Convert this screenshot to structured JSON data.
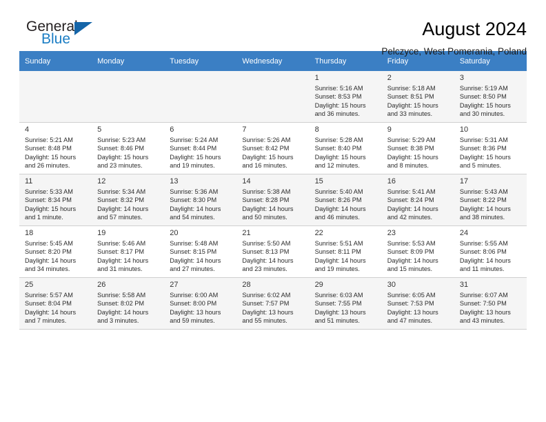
{
  "brand": {
    "name_part1": "General",
    "name_part2": "Blue",
    "triangle_color": "#1565a8",
    "blue_color": "#1a7dc4"
  },
  "header": {
    "title": "August 2024",
    "subtitle": "Pelczyce, West Pomerania, Poland"
  },
  "calendar": {
    "header_bg": "#3b7fc4",
    "header_text_color": "#ffffff",
    "alt_row_bg": "#f5f5f5",
    "weekday_headers": [
      "Sunday",
      "Monday",
      "Tuesday",
      "Wednesday",
      "Thursday",
      "Friday",
      "Saturday"
    ],
    "weeks": [
      [
        {
          "day": "",
          "detail": ""
        },
        {
          "day": "",
          "detail": ""
        },
        {
          "day": "",
          "detail": ""
        },
        {
          "day": "",
          "detail": ""
        },
        {
          "day": "1",
          "detail": "Sunrise: 5:16 AM\nSunset: 8:53 PM\nDaylight: 15 hours\nand 36 minutes."
        },
        {
          "day": "2",
          "detail": "Sunrise: 5:18 AM\nSunset: 8:51 PM\nDaylight: 15 hours\nand 33 minutes."
        },
        {
          "day": "3",
          "detail": "Sunrise: 5:19 AM\nSunset: 8:50 PM\nDaylight: 15 hours\nand 30 minutes."
        }
      ],
      [
        {
          "day": "4",
          "detail": "Sunrise: 5:21 AM\nSunset: 8:48 PM\nDaylight: 15 hours\nand 26 minutes."
        },
        {
          "day": "5",
          "detail": "Sunrise: 5:23 AM\nSunset: 8:46 PM\nDaylight: 15 hours\nand 23 minutes."
        },
        {
          "day": "6",
          "detail": "Sunrise: 5:24 AM\nSunset: 8:44 PM\nDaylight: 15 hours\nand 19 minutes."
        },
        {
          "day": "7",
          "detail": "Sunrise: 5:26 AM\nSunset: 8:42 PM\nDaylight: 15 hours\nand 16 minutes."
        },
        {
          "day": "8",
          "detail": "Sunrise: 5:28 AM\nSunset: 8:40 PM\nDaylight: 15 hours\nand 12 minutes."
        },
        {
          "day": "9",
          "detail": "Sunrise: 5:29 AM\nSunset: 8:38 PM\nDaylight: 15 hours\nand 8 minutes."
        },
        {
          "day": "10",
          "detail": "Sunrise: 5:31 AM\nSunset: 8:36 PM\nDaylight: 15 hours\nand 5 minutes."
        }
      ],
      [
        {
          "day": "11",
          "detail": "Sunrise: 5:33 AM\nSunset: 8:34 PM\nDaylight: 15 hours\nand 1 minute."
        },
        {
          "day": "12",
          "detail": "Sunrise: 5:34 AM\nSunset: 8:32 PM\nDaylight: 14 hours\nand 57 minutes."
        },
        {
          "day": "13",
          "detail": "Sunrise: 5:36 AM\nSunset: 8:30 PM\nDaylight: 14 hours\nand 54 minutes."
        },
        {
          "day": "14",
          "detail": "Sunrise: 5:38 AM\nSunset: 8:28 PM\nDaylight: 14 hours\nand 50 minutes."
        },
        {
          "day": "15",
          "detail": "Sunrise: 5:40 AM\nSunset: 8:26 PM\nDaylight: 14 hours\nand 46 minutes."
        },
        {
          "day": "16",
          "detail": "Sunrise: 5:41 AM\nSunset: 8:24 PM\nDaylight: 14 hours\nand 42 minutes."
        },
        {
          "day": "17",
          "detail": "Sunrise: 5:43 AM\nSunset: 8:22 PM\nDaylight: 14 hours\nand 38 minutes."
        }
      ],
      [
        {
          "day": "18",
          "detail": "Sunrise: 5:45 AM\nSunset: 8:20 PM\nDaylight: 14 hours\nand 34 minutes."
        },
        {
          "day": "19",
          "detail": "Sunrise: 5:46 AM\nSunset: 8:17 PM\nDaylight: 14 hours\nand 31 minutes."
        },
        {
          "day": "20",
          "detail": "Sunrise: 5:48 AM\nSunset: 8:15 PM\nDaylight: 14 hours\nand 27 minutes."
        },
        {
          "day": "21",
          "detail": "Sunrise: 5:50 AM\nSunset: 8:13 PM\nDaylight: 14 hours\nand 23 minutes."
        },
        {
          "day": "22",
          "detail": "Sunrise: 5:51 AM\nSunset: 8:11 PM\nDaylight: 14 hours\nand 19 minutes."
        },
        {
          "day": "23",
          "detail": "Sunrise: 5:53 AM\nSunset: 8:09 PM\nDaylight: 14 hours\nand 15 minutes."
        },
        {
          "day": "24",
          "detail": "Sunrise: 5:55 AM\nSunset: 8:06 PM\nDaylight: 14 hours\nand 11 minutes."
        }
      ],
      [
        {
          "day": "25",
          "detail": "Sunrise: 5:57 AM\nSunset: 8:04 PM\nDaylight: 14 hours\nand 7 minutes."
        },
        {
          "day": "26",
          "detail": "Sunrise: 5:58 AM\nSunset: 8:02 PM\nDaylight: 14 hours\nand 3 minutes."
        },
        {
          "day": "27",
          "detail": "Sunrise: 6:00 AM\nSunset: 8:00 PM\nDaylight: 13 hours\nand 59 minutes."
        },
        {
          "day": "28",
          "detail": "Sunrise: 6:02 AM\nSunset: 7:57 PM\nDaylight: 13 hours\nand 55 minutes."
        },
        {
          "day": "29",
          "detail": "Sunrise: 6:03 AM\nSunset: 7:55 PM\nDaylight: 13 hours\nand 51 minutes."
        },
        {
          "day": "30",
          "detail": "Sunrise: 6:05 AM\nSunset: 7:53 PM\nDaylight: 13 hours\nand 47 minutes."
        },
        {
          "day": "31",
          "detail": "Sunrise: 6:07 AM\nSunset: 7:50 PM\nDaylight: 13 hours\nand 43 minutes."
        }
      ]
    ]
  }
}
